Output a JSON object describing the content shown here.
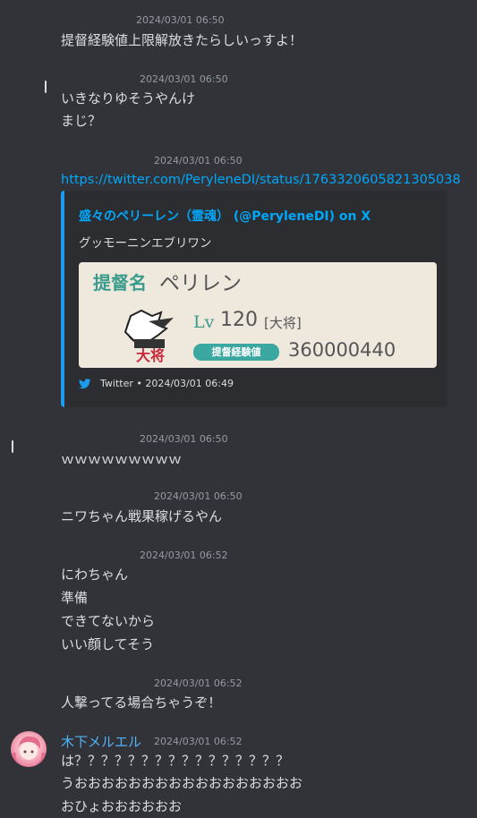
{
  "messages": [
    {
      "timestamp": "2024/03/01 06:50",
      "lines": [
        "提督経験値上限解放きたらしいっすよ！"
      ]
    },
    {
      "timestamp": "2024/03/01 06:50",
      "lines": [
        "いきなりゆそうやんけ",
        "まじ？"
      ]
    },
    {
      "timestamp": "2024/03/01 06:50",
      "link": "https://twitter.com/PeryleneDI/status/1763320605821305038"
    },
    {
      "timestamp": "2024/03/01 06:50",
      "lines": [
        "ｗｗｗｗｗｗｗｗｗ"
      ]
    },
    {
      "timestamp": "2024/03/01 06:50",
      "lines": [
        "ニワちゃん戦果稼げるやん"
      ]
    },
    {
      "timestamp": "2024/03/01 06:52",
      "lines": [
        "にわちゃん",
        "準備",
        "できてないから",
        "いい顔してそう"
      ]
    },
    {
      "timestamp": "2024/03/01 06:52",
      "lines": [
        "人撃ってる場合ちゃうぞ！"
      ]
    },
    {
      "author": "木下メルエル",
      "timestamp": "2024/03/01 06:52",
      "lines": [
        "は？？？？？？？？？？？？？？？？",
        "うおおおおおおおおおおおおおおおおお",
        "おひょおおおおおお"
      ]
    }
  ],
  "embed": {
    "author": "盛々のペリーレン（霊魂） (@PeryleneDI) on X",
    "description": "グッモーニンエブリワン",
    "footer": "Twitter • 2024/03/01 06:49",
    "accent_color": "#1d9bf0",
    "image": {
      "title": "提督名",
      "name": "ペリレン",
      "lv_label": "Lv",
      "level": "120",
      "rank": "[大将]",
      "rank_badge": "大将",
      "xp_label": "提督経験値",
      "xp_value": "360000440"
    }
  }
}
